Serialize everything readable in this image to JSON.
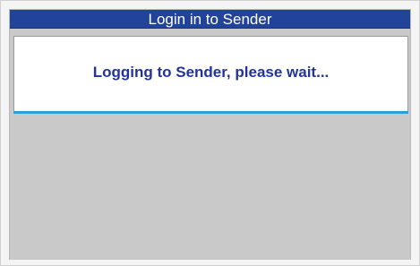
{
  "dialog": {
    "title": "Login in to Sender",
    "message": "Logging to Sender, please wait..."
  },
  "colors": {
    "title_bar": "#22439a",
    "message_text": "#22349a",
    "accent": "#2f9fd8",
    "background": "#c9c9c9"
  }
}
